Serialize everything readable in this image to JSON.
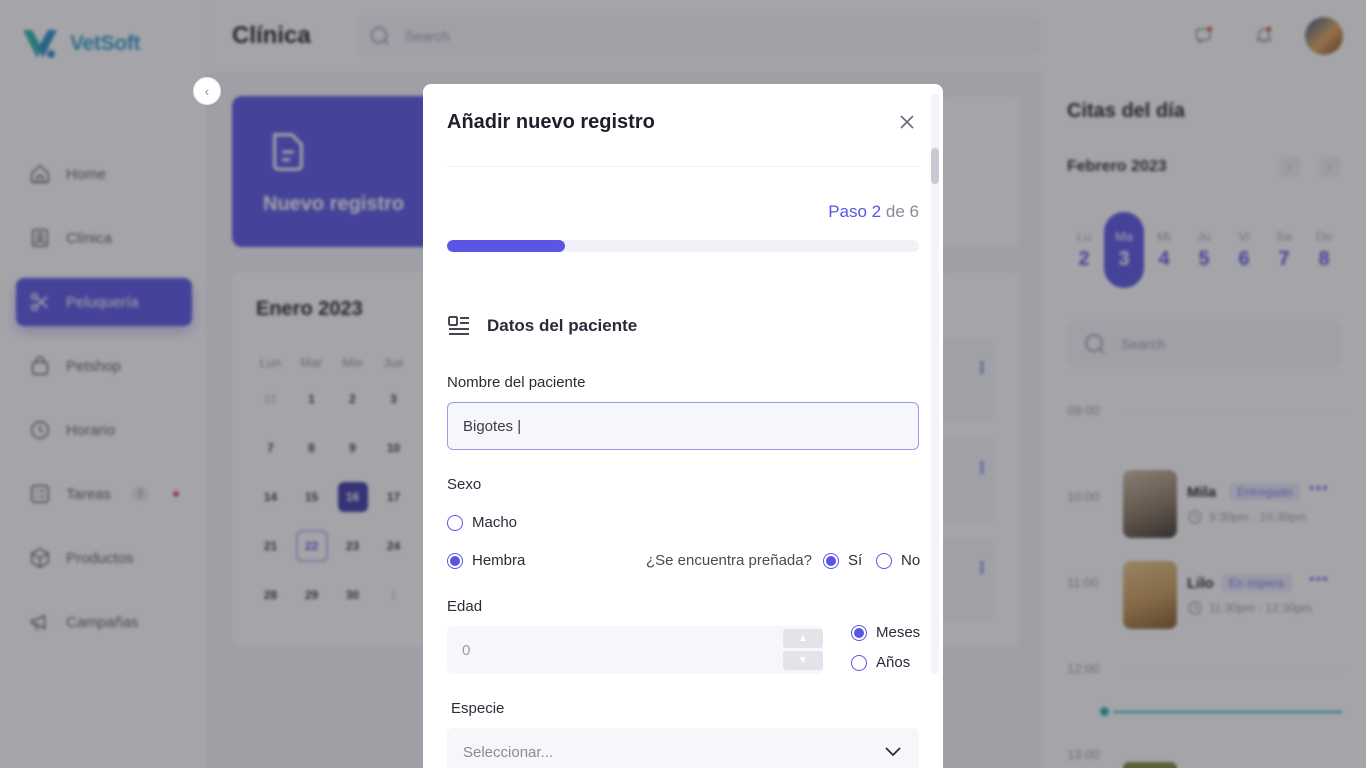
{
  "app": {
    "brand": "VetSoft",
    "page_title": "Clínica",
    "search_placeholder": "Search",
    "collapse_glyph": "‹"
  },
  "sidebar": {
    "items": [
      {
        "label": "Home",
        "icon": "home-icon"
      },
      {
        "label": "Clínica",
        "icon": "clinic-icon"
      },
      {
        "label": "Peluquería",
        "icon": "scissors-icon",
        "active": true
      },
      {
        "label": "Petshop",
        "icon": "bag-icon"
      },
      {
        "label": "Horario",
        "icon": "clock-icon"
      },
      {
        "label": "Tareas",
        "icon": "tasks-icon",
        "count": "3"
      },
      {
        "label": "Productos",
        "icon": "box-icon"
      },
      {
        "label": "Campañas",
        "icon": "megaphone-icon"
      }
    ]
  },
  "new_record_card": {
    "label": "Nuevo registro"
  },
  "calendar": {
    "title": "Enero 2023",
    "headers": [
      "Lun",
      "Mar",
      "Mie",
      "Jue"
    ],
    "rows": [
      [
        "31",
        "1",
        "2",
        "3"
      ],
      [
        "7",
        "8",
        "9",
        "10"
      ],
      [
        "14",
        "15",
        "16",
        "17"
      ],
      [
        "21",
        "22",
        "23",
        "24"
      ],
      [
        "28",
        "29",
        "30",
        "1"
      ]
    ],
    "selected": "16",
    "today": "22"
  },
  "right_panel": {
    "title": "Citas del día",
    "month": "Febrero 2023",
    "prev": "‹",
    "next": "›",
    "days": [
      {
        "name": "Lu",
        "num": "2"
      },
      {
        "name": "Ma",
        "num": "3",
        "active": true
      },
      {
        "name": "Mi",
        "num": "4"
      },
      {
        "name": "Ju",
        "num": "5"
      },
      {
        "name": "Vi",
        "num": "6"
      },
      {
        "name": "Sa",
        "num": "7"
      },
      {
        "name": "Do",
        "num": "8"
      }
    ],
    "search_placeholder": "Search",
    "times": [
      "09:00",
      "10:00",
      "11:00",
      "12:00",
      "13:00"
    ],
    "appointments": [
      {
        "name": "Mila",
        "status": "Entregado",
        "time": "9:30pm - 10:30pm"
      },
      {
        "name": "Lilo",
        "status": "En espera",
        "time": "11:30pm - 12:30pm"
      }
    ]
  },
  "modal": {
    "title": "Añadir nuevo registro",
    "step_label": "Paso",
    "step_current": "2",
    "step_of": "de",
    "step_total": "6",
    "progress_fraction": 0.25,
    "section_title": "Datos del paciente",
    "patient_name_label": "Nombre del paciente",
    "patient_name_value": "Bigotes |",
    "sex_label": "Sexo",
    "sex_options": [
      "Macho",
      "Hembra"
    ],
    "sex_selected": "Hembra",
    "pregnant_question": "¿Se encuentra preñada?",
    "pregnant_options": [
      "Sí",
      "No"
    ],
    "pregnant_selected": "Sí",
    "age_label": "Edad",
    "age_value": "0",
    "age_up": "▲",
    "age_down": "▼",
    "age_units": [
      "Meses",
      "Años"
    ],
    "age_unit_selected": "Meses",
    "species_label": "Especie",
    "species_placeholder": "Seleccionar..."
  },
  "colors": {
    "accent": "#5b55e3",
    "overlay": "rgba(40,40,50,0.42)",
    "teal": "#1fb5b5"
  }
}
